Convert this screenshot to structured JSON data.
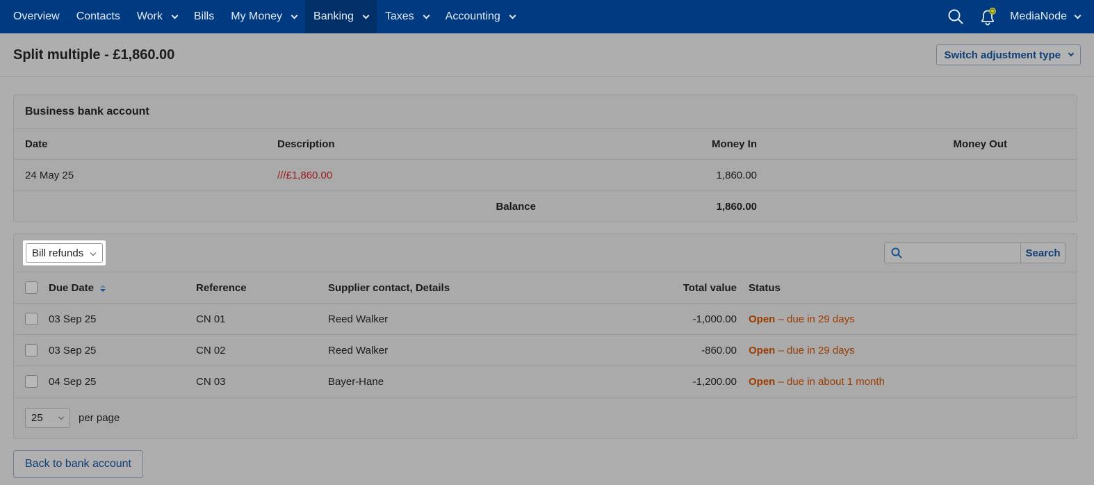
{
  "nav": {
    "items": [
      {
        "label": "Overview",
        "dropdown": false
      },
      {
        "label": "Contacts",
        "dropdown": false
      },
      {
        "label": "Work",
        "dropdown": true
      },
      {
        "label": "Bills",
        "dropdown": false
      },
      {
        "label": "My Money",
        "dropdown": true
      },
      {
        "label": "Banking",
        "dropdown": true,
        "active": true
      },
      {
        "label": "Taxes",
        "dropdown": true
      },
      {
        "label": "Accounting",
        "dropdown": true
      }
    ],
    "user": "MediaNode",
    "icons": [
      "search-icon",
      "bell-icon",
      "chevron-down-icon"
    ]
  },
  "header": {
    "title": "Split multiple - £1,860.00",
    "switch_button": "Switch adjustment type"
  },
  "bank_card": {
    "title": "Business bank account",
    "columns": {
      "date": "Date",
      "description": "Description",
      "money_in": "Money In",
      "money_out": "Money Out"
    },
    "row": {
      "date": "24 May 25",
      "description": "///£1,860.00",
      "money_in": "1,860.00",
      "money_out": ""
    },
    "balance_label": "Balance",
    "balance_value": "1,860.00"
  },
  "bills_card": {
    "filter_value": "Bill refunds",
    "search_placeholder": "",
    "search_button": "Search",
    "columns": {
      "due_date": "Due Date",
      "reference": "Reference",
      "supplier": "Supplier contact, Details",
      "total": "Total value",
      "status": "Status"
    },
    "rows": [
      {
        "due_date": "03 Sep 25",
        "reference": "CN 01",
        "supplier": "Reed Walker",
        "total": "-1,000.00",
        "status_main": "Open",
        "status_detail": " – due in 29 days"
      },
      {
        "due_date": "03 Sep 25",
        "reference": "CN 02",
        "supplier": "Reed Walker",
        "total": "-860.00",
        "status_main": "Open",
        "status_detail": " – due in 29 days"
      },
      {
        "due_date": "04 Sep 25",
        "reference": "CN 03",
        "supplier": "Bayer-Hane",
        "total": "-1,200.00",
        "status_main": "Open",
        "status_detail": " – due in about 1 month"
      }
    ],
    "per_page_value": "25",
    "per_page_label": "per page"
  },
  "back_button": "Back to bank account",
  "colors": {
    "nav_bg": "#003a80",
    "link": "#103d73",
    "status": "#9a3c00",
    "description_red": "#9c1a1a"
  }
}
